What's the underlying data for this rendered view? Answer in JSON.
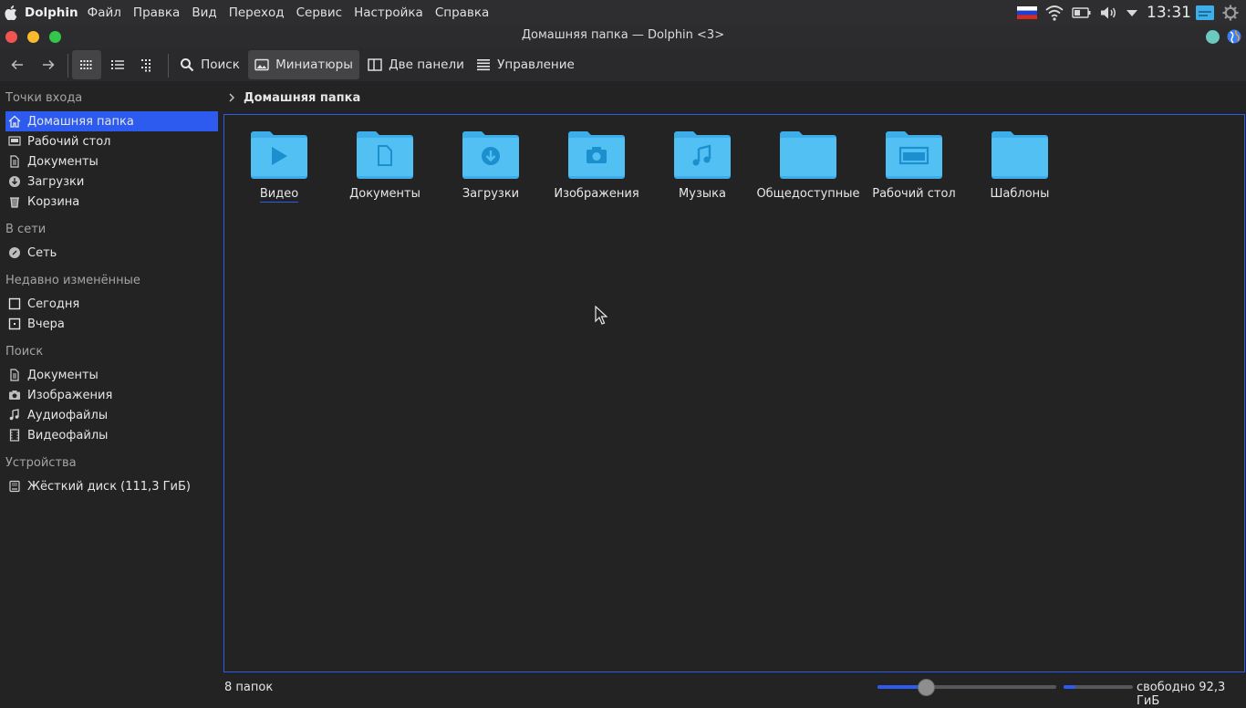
{
  "menubar": {
    "app_name": "Dolphin",
    "items": [
      "Файл",
      "Правка",
      "Вид",
      "Переход",
      "Сервис",
      "Настройка",
      "Справка"
    ],
    "clock": "13:31"
  },
  "window": {
    "title": "Домашняя папка — Dolphin <3>"
  },
  "toolbar": {
    "search_label": "Поиск",
    "preview_label": "Миниатюры",
    "split_label": "Две панели",
    "control_label": "Управление"
  },
  "sidebar": {
    "places_header": "Точки входа",
    "places": [
      "Домашняя папка",
      "Рабочий стол",
      "Документы",
      "Загрузки",
      "Корзина"
    ],
    "network_header": "В сети",
    "network": [
      "Сеть"
    ],
    "recent_header": "Недавно изменённые",
    "recent": [
      "Сегодня",
      "Вчера"
    ],
    "search_header": "Поиск",
    "search": [
      "Документы",
      "Изображения",
      "Аудиофайлы",
      "Видеофайлы"
    ],
    "devices_header": "Устройства",
    "devices": [
      "Жёсткий диск (111,3 ГиБ)"
    ]
  },
  "breadcrumb": {
    "current": "Домашняя папка"
  },
  "folders": [
    "Видео",
    "Документы",
    "Загрузки",
    "Изображения",
    "Музыка",
    "Общедоступные",
    "Рабочий стол",
    "Шаблоны"
  ],
  "status": {
    "count": "8 папок",
    "free": "свободно 92,3 ГиБ",
    "zoom_fraction": 0.27,
    "disk_used_fraction": 0.17
  },
  "colors": {
    "accent": "#2e5bef",
    "folder": "#3daee9"
  }
}
